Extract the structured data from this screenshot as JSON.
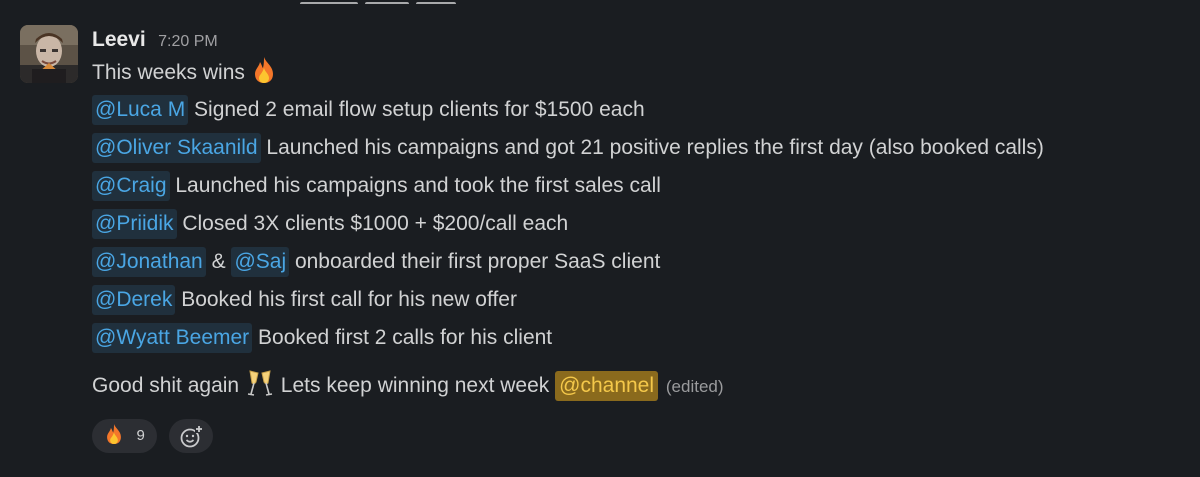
{
  "message": {
    "author": "Leevi",
    "timestamp": "7:20 PM",
    "title": "This weeks wins",
    "title_emoji": "fire-emoji",
    "items": [
      {
        "mentions": [
          "@Luca M"
        ],
        "text": "Signed 2 email flow setup clients for $1500 each"
      },
      {
        "mentions": [
          "@Oliver Skaanild"
        ],
        "text": "Launched his campaigns and got 21 positive replies the first day (also booked calls)"
      },
      {
        "mentions": [
          "@Craig"
        ],
        "text": "Launched his campaigns and took the first sales call"
      },
      {
        "mentions": [
          "@Priidik"
        ],
        "text": "Closed 3X clients $1000 + $200/call each"
      },
      {
        "mentions": [
          "@Jonathan",
          "@Saj"
        ],
        "joiner": "&",
        "text": "onboarded their first proper SaaS client"
      },
      {
        "mentions": [
          "@Derek"
        ],
        "text": "Booked his first call for his new offer"
      },
      {
        "mentions": [
          "@Wyatt Beemer"
        ],
        "text": "Booked first 2 calls for his client"
      }
    ],
    "closing_before": "Good shit again",
    "closing_emoji": "champagne-glasses-emoji",
    "closing_after": "Lets keep winning next week",
    "closing_mention": "@channel",
    "edited_label": "(edited)"
  },
  "reactions": [
    {
      "emoji": "fire-emoji",
      "count": "9"
    }
  ],
  "add_reaction_icon": "add-reaction-icon",
  "colors": {
    "background": "#1a1d21",
    "mention_bg": "#20303d",
    "mention_text": "#4aa6e4",
    "channel_mention_bg": "#8a6a1d",
    "channel_mention_text": "#f4c84a"
  }
}
